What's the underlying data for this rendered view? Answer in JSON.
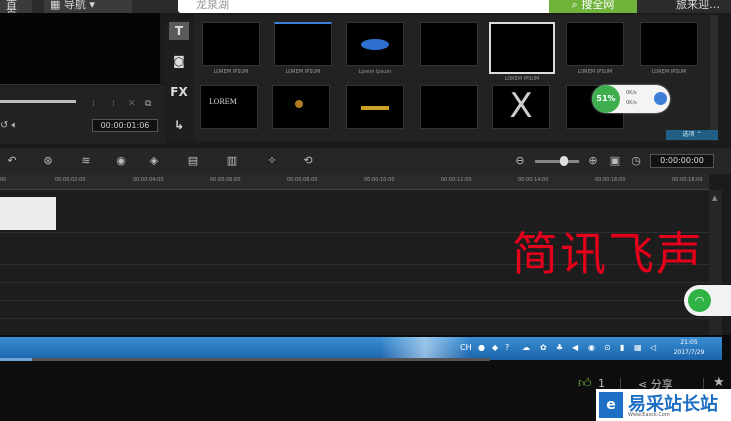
{
  "browser": {
    "home_tab": "首页",
    "nav_label": "导航",
    "search_placeholder": "龙泉湖",
    "search_button": "搜全网",
    "top_right_text": "旅来迎…"
  },
  "editor": {
    "preview_timecode": "00:00:01:06",
    "side_tools": [
      "T",
      "FX"
    ],
    "library": {
      "row1": [
        {
          "caption": "LOREM IPSUM"
        },
        {
          "caption": "LOREM IPSUM"
        },
        {
          "caption": "Lorem Ipsum"
        },
        {
          "caption": ""
        },
        {
          "caption": "LOREM IPSUM"
        },
        {
          "caption": "LOREM IPSUM"
        },
        {
          "caption": "LOREM IPSUM"
        }
      ],
      "row2_captions": [
        "LOREM",
        "",
        "",
        "",
        "",
        ""
      ],
      "bottom_bar": "选项 ⌃"
    },
    "speed_badge": {
      "percent": "51%",
      "up": "0K/s",
      "down": "0K/s"
    },
    "timeline_timecode": "0:00:00:00",
    "ruler_ticks": [
      "00",
      "00:00:02:00",
      "00:00:04:00",
      "00:00:06:00",
      "00:00:08:00",
      "00:00:10:00",
      "00:00:12:00",
      "00:00:14:00",
      "00:00:16:00",
      "00:00:18:00",
      "00:00:20:00"
    ],
    "watermark": "简讯飞声"
  },
  "taskbar": {
    "time": "21:05",
    "date": "2017/7/29"
  },
  "footer": {
    "like_count": "1",
    "share_label": "分享",
    "site_name": "易采站长站",
    "site_url": "Www.Easck.Com"
  },
  "colors": {
    "search_green": "#6fb33a",
    "watermark_red": "#e2001a",
    "taskbar_blue": "#2a7bc6"
  }
}
